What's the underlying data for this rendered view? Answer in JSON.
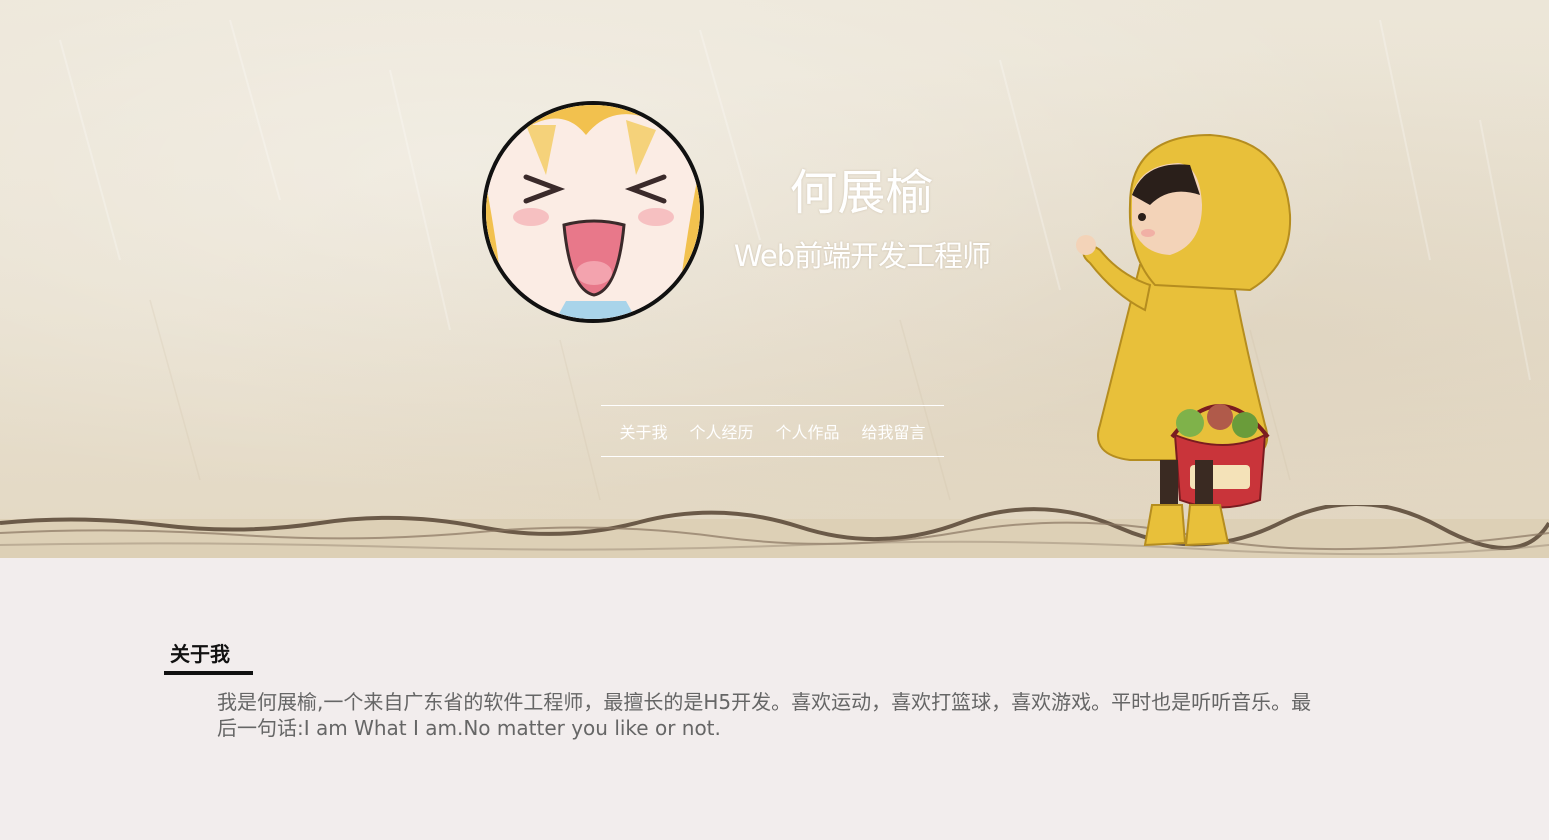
{
  "profile": {
    "name": "何展榆",
    "role": "Web前端开发工程师"
  },
  "nav": {
    "items": [
      {
        "label": "关于我"
      },
      {
        "label": "个人经历"
      },
      {
        "label": "个人作品"
      },
      {
        "label": "给我留言"
      }
    ]
  },
  "about": {
    "title": "关于我",
    "text": "我是何展榆,一个来自广东省的软件工程师，最擅长的是H5开发。喜欢运动，喜欢打篮球，喜欢游戏。平时也是听听音乐。最后一句话:I am What I am.No matter you like or not."
  },
  "colors": {
    "page_background": "#f2eded",
    "hero_background": "#e9e2d2",
    "text_gray": "#666666",
    "accent_dark": "#111111",
    "raincoat_yellow": "#e8c03a"
  },
  "icons": {
    "avatar": "anime-girl-avatar",
    "illustration": "child-in-yellow-raincoat"
  }
}
